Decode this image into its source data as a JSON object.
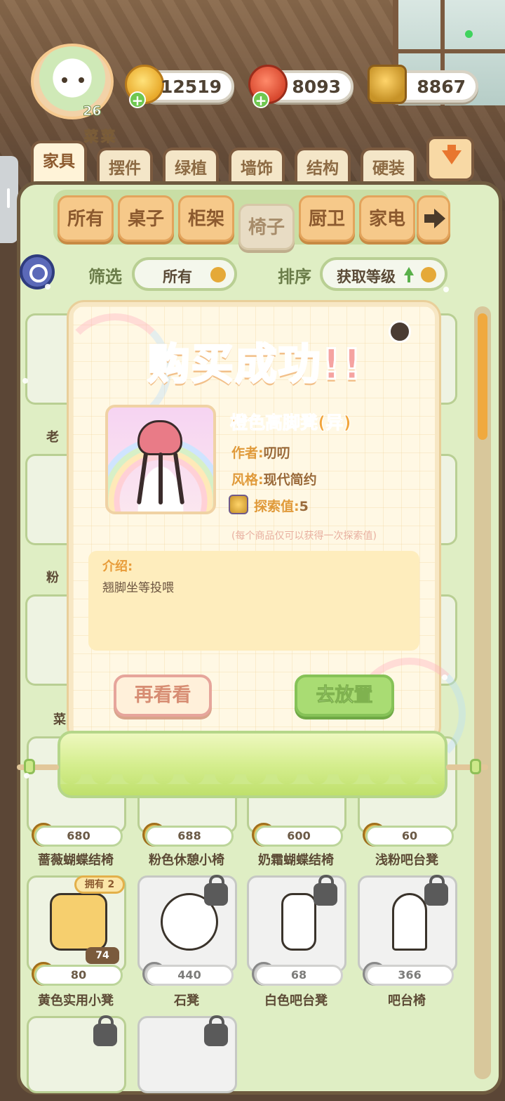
{
  "header": {
    "player_name": "菜菜",
    "level": "26",
    "currencies": [
      {
        "name": "gold-coin",
        "value": "12519"
      },
      {
        "name": "sausage",
        "value": "8093"
      },
      {
        "name": "explore-book",
        "value": "8867"
      }
    ]
  },
  "categories": [
    "家具",
    "摆件",
    "绿植",
    "墙饰",
    "结构",
    "硬装"
  ],
  "subcategories": [
    "所有",
    "桌子",
    "柜架",
    "椅子",
    "厨卫",
    "家电"
  ],
  "filter": {
    "label": "筛选",
    "value": "所有"
  },
  "sort": {
    "label": "排序",
    "value": "获取等级"
  },
  "side_items": [
    "老",
    "粉",
    "菜"
  ],
  "items": [
    {
      "name": "蔷薇蝴蝶结椅",
      "price": "680",
      "locked": false
    },
    {
      "name": "粉色休憩小椅",
      "price": "688",
      "locked": false
    },
    {
      "name": "奶霜蝴蝶结椅",
      "price": "600",
      "locked": false
    },
    {
      "name": "浅粉吧台凳",
      "price": "60",
      "locked": false
    },
    {
      "name": "黄色实用小凳",
      "price": "80",
      "locked": false,
      "owned": "拥有 2",
      "count": "74"
    },
    {
      "name": "石凳",
      "price": "440",
      "locked": true
    },
    {
      "name": "白色吧台凳",
      "price": "68",
      "locked": true
    },
    {
      "name": "吧台椅",
      "price": "366",
      "locked": true
    }
  ],
  "modal": {
    "title": "购买成功!!",
    "item_name": "橙色高脚凳(异)",
    "author_label": "作者:",
    "author": "叨叨",
    "style_label": "风格:",
    "style": "现代简约",
    "explore_label": "探索值:",
    "explore_value": "5",
    "note": "(每个商品仅可以获得一次探索值)",
    "intro_label": "介绍:",
    "intro_text": "翘脚坐等投喂",
    "btn_again": "再看看",
    "btn_place": "去放置"
  },
  "colors": {
    "accent_green": "#a9dc73",
    "accent_orange": "#f2a53b",
    "panel": "#dfeec4"
  }
}
